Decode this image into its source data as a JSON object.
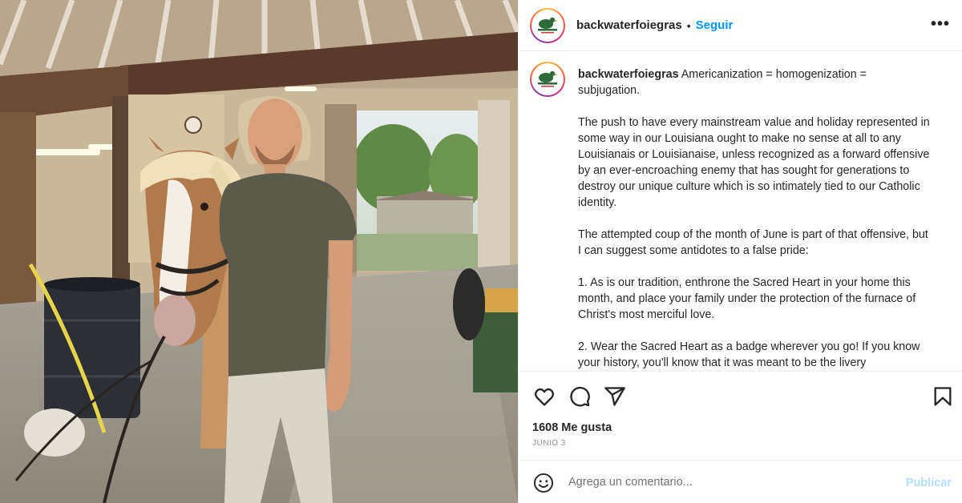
{
  "post": {
    "username": "backwaterfoiegras",
    "follow_label": "Seguir",
    "separator": "•",
    "more_label": "•••",
    "avatar_icon": "backwater-duck-logo-icon"
  },
  "caption": {
    "username": "backwaterfoiegras",
    "paragraphs": [
      "Americanization = homogenization = subjugation.",
      "The push to have every mainstream value and holiday represented in some way in our Louisiana ought to make no sense at all to any Louisianais or Louisianaise, unless recognized as a forward offensive by an ever-encroaching enemy that has sought for generations to destroy our unique culture which is so intimately tied to our Catholic identity.",
      "The attempted coup of the month of June is part of that offensive, but I can suggest some antidotes to a false pride:",
      "1. As is our tradition, enthrone the Sacred Heart in your home this month, and place your family under the protection of the furnace of Christ's most merciful love.",
      "2. Wear the Sacred Heart as a badge wherever you go! If you know your history, you'll know that it was meant to be the livery"
    ]
  },
  "actions": {
    "icons": [
      "heart-icon",
      "comment-icon",
      "share-icon",
      "bookmark-icon"
    ],
    "likes": "1608 Me gusta",
    "date": "Junio 3"
  },
  "comment": {
    "placeholder": "Agrega un comentario...",
    "publish_label": "Publicar",
    "emoji_icon": "emoji-icon"
  },
  "colors": {
    "accent": "#0095f6",
    "publish_disabled": "#b2dffc",
    "text": "#262626",
    "muted": "#8e8e8e",
    "divider": "#efefef"
  }
}
